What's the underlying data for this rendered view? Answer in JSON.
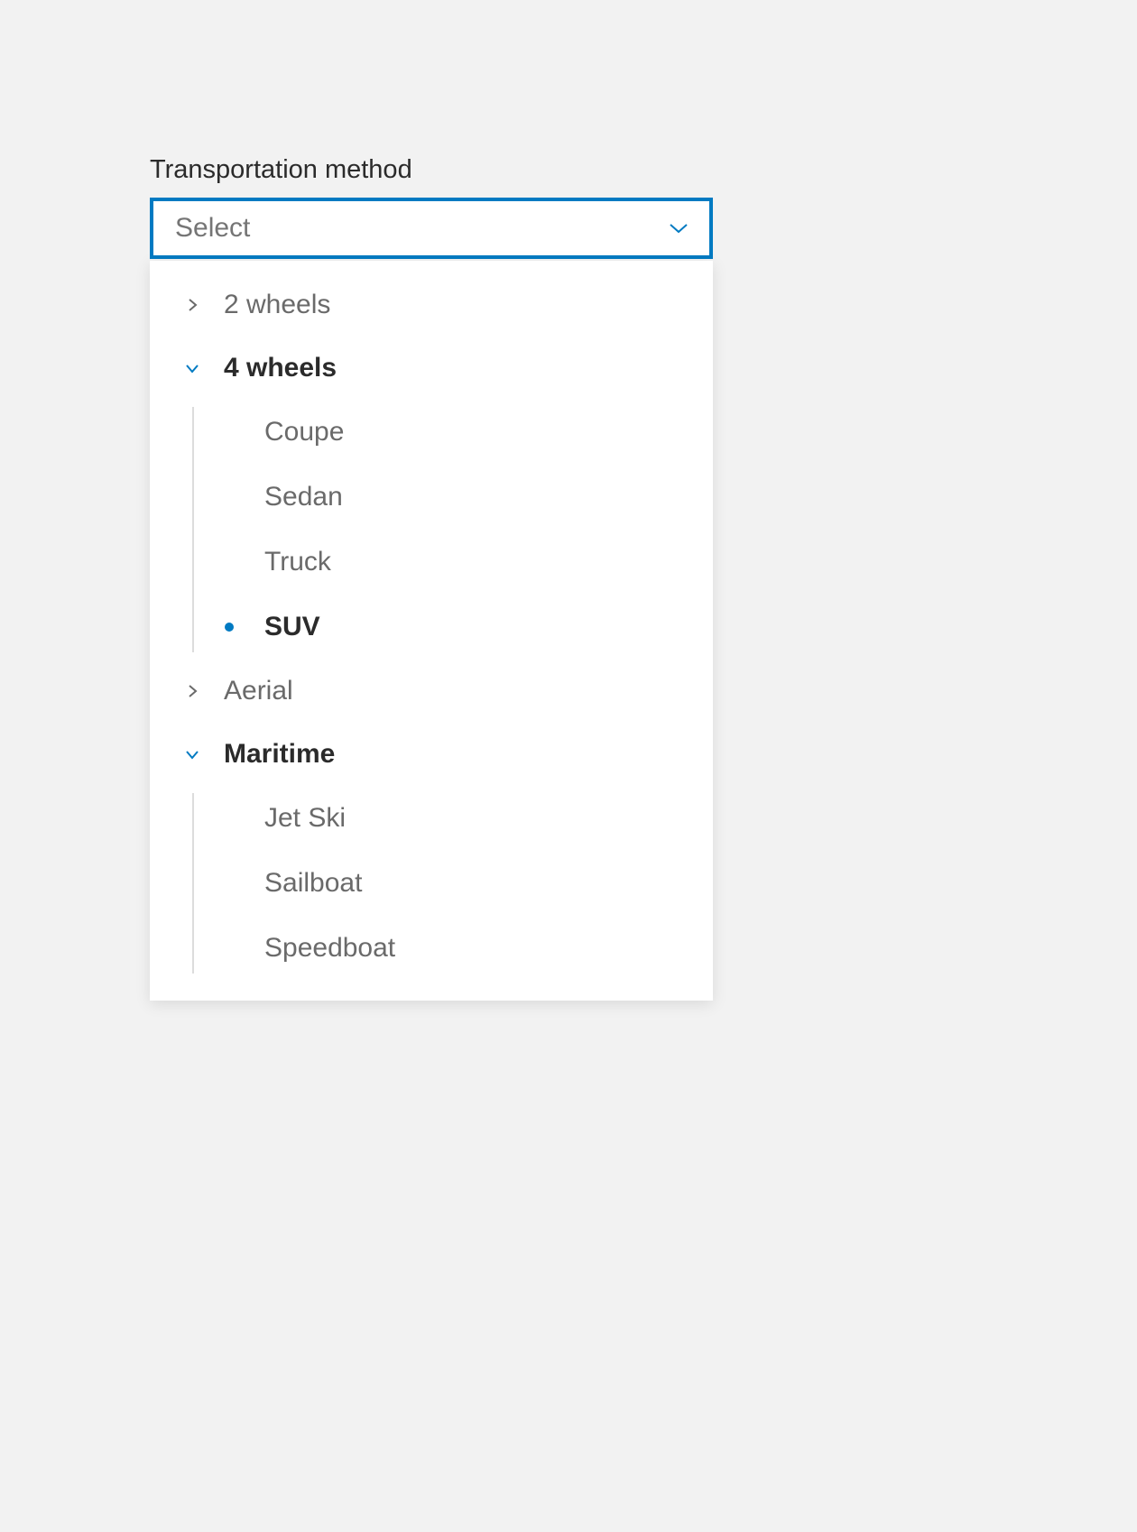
{
  "field": {
    "label": "Transportation method",
    "placeholder": "Select"
  },
  "groups": {
    "two_wheels": {
      "label": "2 wheels"
    },
    "four_wheels": {
      "label": "4 wheels",
      "items": {
        "coupe": "Coupe",
        "sedan": "Sedan",
        "truck": "Truck",
        "suv": "SUV"
      }
    },
    "aerial": {
      "label": "Aerial"
    },
    "maritime": {
      "label": "Maritime",
      "items": {
        "jetski": "Jet Ski",
        "sailboat": "Sailboat",
        "speedboat": "Speedboat"
      }
    }
  },
  "colors": {
    "accent": "#007ac2"
  }
}
